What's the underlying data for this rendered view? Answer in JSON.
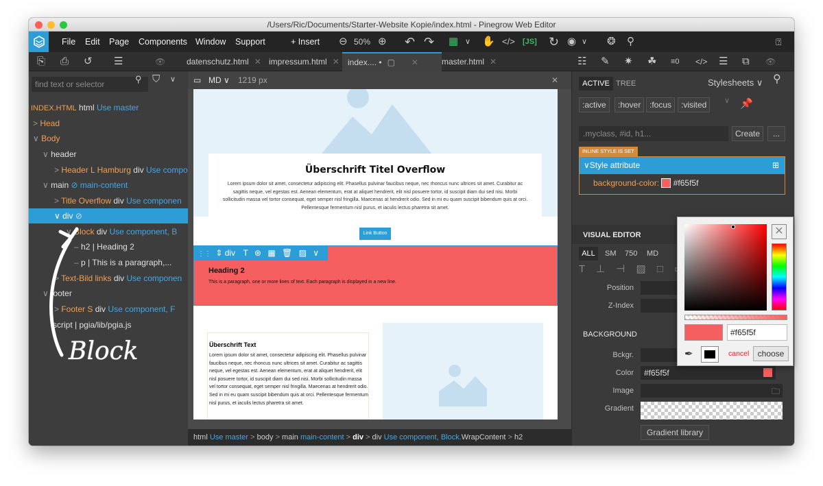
{
  "window": {
    "title": "/Users/Ric/Documents/Starter-Website Kopie/index.html - Pinegrow Web Editor"
  },
  "menu": {
    "items": [
      "File",
      "Edit",
      "Page",
      "Components",
      "Window",
      "Support"
    ],
    "insert": "Insert",
    "zoom": "50%"
  },
  "tabs": [
    {
      "label": "datenschutz.html"
    },
    {
      "label": "impressum.html"
    },
    {
      "label": "index....",
      "modified": "•"
    },
    {
      "label": "master.html"
    }
  ],
  "left": {
    "search_placeholder": "find text or selector",
    "tree": {
      "index_file": "INDEX.HTML",
      "index_tag": "html",
      "index_master": "Use master",
      "head": "Head",
      "body": "Body",
      "header": "header",
      "header_item": "Header L Hamburg",
      "header_tag": "div",
      "header_comp": "Use compo",
      "main": "main",
      "main_class": "main-content",
      "title_item": "Title Overflow",
      "title_tag": "div",
      "title_comp": "Use componen",
      "div": "div",
      "block_item": "Block",
      "block_tag": "div",
      "block_comp": "Use component,",
      "block_extra": "B",
      "h2_item": "h2 | Heading 2",
      "p_item": "p | This is a paragraph,...",
      "textbild_item": "Text-Bild links",
      "textbild_tag": "div",
      "textbild_comp": "Use componen",
      "footer": "footer",
      "footer_item": "Footer S",
      "footer_tag": "div",
      "footer_comp": "Use component,",
      "footer_extra": "F",
      "script_item": "script | pgia/lib/pgia.js"
    }
  },
  "canvas": {
    "breakpoint": "MD",
    "width_label": "1219 px",
    "hero_title": "Überschrift Titel Overflow",
    "hero_text": "Lorem ipsum dolor sit amet, consectetur adipiscing elit. Phasellus pulvinar faucibus neque, nec rhoncus nunc ultrices sit amet. Curabitur ac sagittis neque, vel egestas est. Aenean elementum, erat at aliquet hendrerit, elit nisl posuere tortor, id suscipit diam dui sed nisi. Morbi sollicitudin massa vel tortor consequat, eget semper nisl fringilla. Maecenas at hendrerit odio. Sed in mi eu quam suscipit bibendum quis at orci. Pellentesque fermentum nisl purus, et iaculis lectus pharetra sit amet.",
    "link_button": "Link Button",
    "block_heading": "Heading 2",
    "block_text": "This is a paragraph, one or more lines of text. Each paragraph is displayed in a new line.",
    "text_title": "Überschrift Text",
    "text_body": "Lorem ipsum dolor sit amet, consectetur adipiscing elit. Phasellus pulvinar faucibus neque, nec rhoncus nunc ultrices sit amet. Curabitur ac sagittis neque, vel egestas est. Aenean elementum, erat at aliquet hendrerit, elit nisl posuere tortor, id suscipit diam dui sed nisi. Morbi sollicitudin massa vel tortor consequat, eget semper nisl fringilla. Maecenas at hendrerit odio. Sed in mi eu quam suscipit bibendum quis at orci. Pellentesque fermentum nisl purus, et iaculis lectus pharetra sit amet.",
    "toolbar_tag": "div"
  },
  "breadcrumb": {
    "html": "html",
    "html_master": "Use master",
    "body": "body",
    "main": "main",
    "main_class": "main-content",
    "div1": "div",
    "div2": "div",
    "div2_comp": "Use component, Block.",
    "div2_wrap": "WrapContent",
    "h2": "h2"
  },
  "right": {
    "tab_active": "ACTIVE",
    "tab_tree": "TREE",
    "stylesheets": "Stylesheets",
    "pseudo": [
      ":active",
      ":hover",
      ":focus",
      ":visited"
    ],
    "class_placeholder": ".myclass, #id, h1...",
    "create": "Create",
    "more": "...",
    "inline_badge": "INLINE STYLE IS SET",
    "style_attr": "Style attribute",
    "bg_prop": "background-color:",
    "bg_value": "#f65f5f",
    "visual_editor": "VISUAL EDITOR",
    "bp": [
      "ALL",
      "SM",
      "750",
      "MD"
    ],
    "position": "Position",
    "zindex": "Z-Index",
    "background": "BACKGROUND",
    "bckgr": "Bckgr.",
    "color": "Color",
    "color_value": "#f65f5f",
    "image": "Image",
    "gradient": "Gradient",
    "gradient_library": "Gradient library"
  },
  "picker": {
    "hex": "#f65f5f",
    "cancel": "cancel",
    "choose": "choose"
  },
  "annotation": "Block",
  "colors": {
    "accent": "#2c9dd6",
    "block": "#f65f5f",
    "orange": "#f0a050"
  }
}
